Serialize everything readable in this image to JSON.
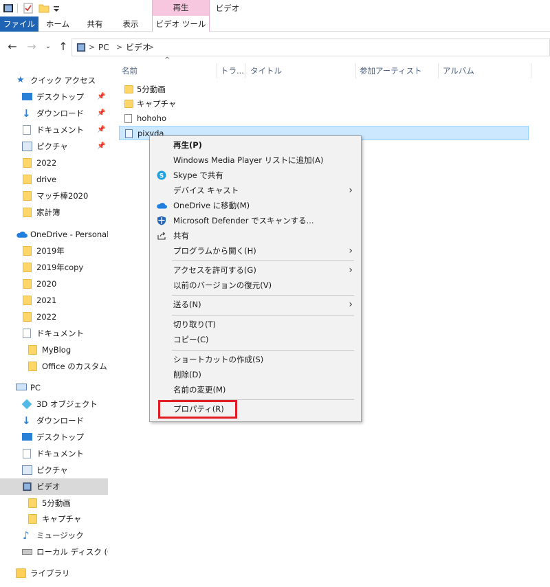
{
  "title_bar": {
    "icons": [
      "video-folder-icon",
      "properties-check-icon",
      "folder-icon",
      "dropdown-arrow-icon"
    ]
  },
  "ribbon": {
    "tabs": [
      {
        "label": "ファイル"
      },
      {
        "label": "ホーム"
      },
      {
        "label": "共有"
      },
      {
        "label": "表示"
      }
    ],
    "contextual_group": "再生",
    "contextual_tab": "ビデオ ツール",
    "window_title": "ビデオ",
    "accent_color": "#1f63b4",
    "contextual_color": "#f7c6df"
  },
  "address": {
    "crumbs": [
      "PC",
      "ビデオ"
    ],
    "separator": ">"
  },
  "nav": {
    "quick_access": "クイック アクセス",
    "items": [
      {
        "label": "デスクトップ"
      },
      {
        "label": "ダウンロード"
      },
      {
        "label": "ドキュメント"
      },
      {
        "label": "ピクチャ"
      },
      {
        "label": "2022"
      },
      {
        "label": "drive"
      },
      {
        "label": "マッチ棒2020"
      },
      {
        "label": "家計簿"
      },
      {
        "label": "OneDrive - Personal"
      },
      {
        "label": "2019年"
      },
      {
        "label": "2019年copy"
      },
      {
        "label": "2020"
      },
      {
        "label": "2021"
      },
      {
        "label": "2022"
      },
      {
        "label": "ドキュメント"
      },
      {
        "label": "MyBlog"
      },
      {
        "label": "Office のカスタム テン"
      },
      {
        "label": "PC"
      },
      {
        "label": "3D オブジェクト"
      },
      {
        "label": "ダウンロード"
      },
      {
        "label": "デスクトップ"
      },
      {
        "label": "ドキュメント"
      },
      {
        "label": "ピクチャ"
      },
      {
        "label": "ビデオ"
      },
      {
        "label": "5分動画"
      },
      {
        "label": "キャプチャ"
      },
      {
        "label": "ミュージック"
      },
      {
        "label": "ローカル ディスク (C:)"
      },
      {
        "label": "ライブラリ"
      }
    ]
  },
  "content": {
    "columns": [
      "名前",
      "トラ...",
      "タイトル",
      "参加アーティスト",
      "アルバム"
    ],
    "files": [
      {
        "name": "5分動画"
      },
      {
        "name": "キャプチャ"
      },
      {
        "name": "hohoho"
      },
      {
        "name": "pixyda"
      }
    ]
  },
  "context_menu": {
    "items": [
      {
        "label": "再生(P)"
      },
      {
        "label": "Windows Media Player リストに追加(A)"
      },
      {
        "label": "Skype で共有"
      },
      {
        "label": "デバイス キャスト"
      },
      {
        "label": "OneDrive に移動(M)"
      },
      {
        "label": "Microsoft Defender でスキャンする..."
      },
      {
        "label": "共有"
      },
      {
        "label": "プログラムから開く(H)"
      },
      {
        "label": "アクセスを許可する(G)"
      },
      {
        "label": "以前のバージョンの復元(V)"
      },
      {
        "label": "送る(N)"
      },
      {
        "label": "切り取り(T)"
      },
      {
        "label": "コピー(C)"
      },
      {
        "label": "ショートカットの作成(S)"
      },
      {
        "label": "削除(D)"
      },
      {
        "label": "名前の変更(M)"
      },
      {
        "label": "プロパティ(R)"
      }
    ],
    "highlight_color": "#e31b23"
  }
}
